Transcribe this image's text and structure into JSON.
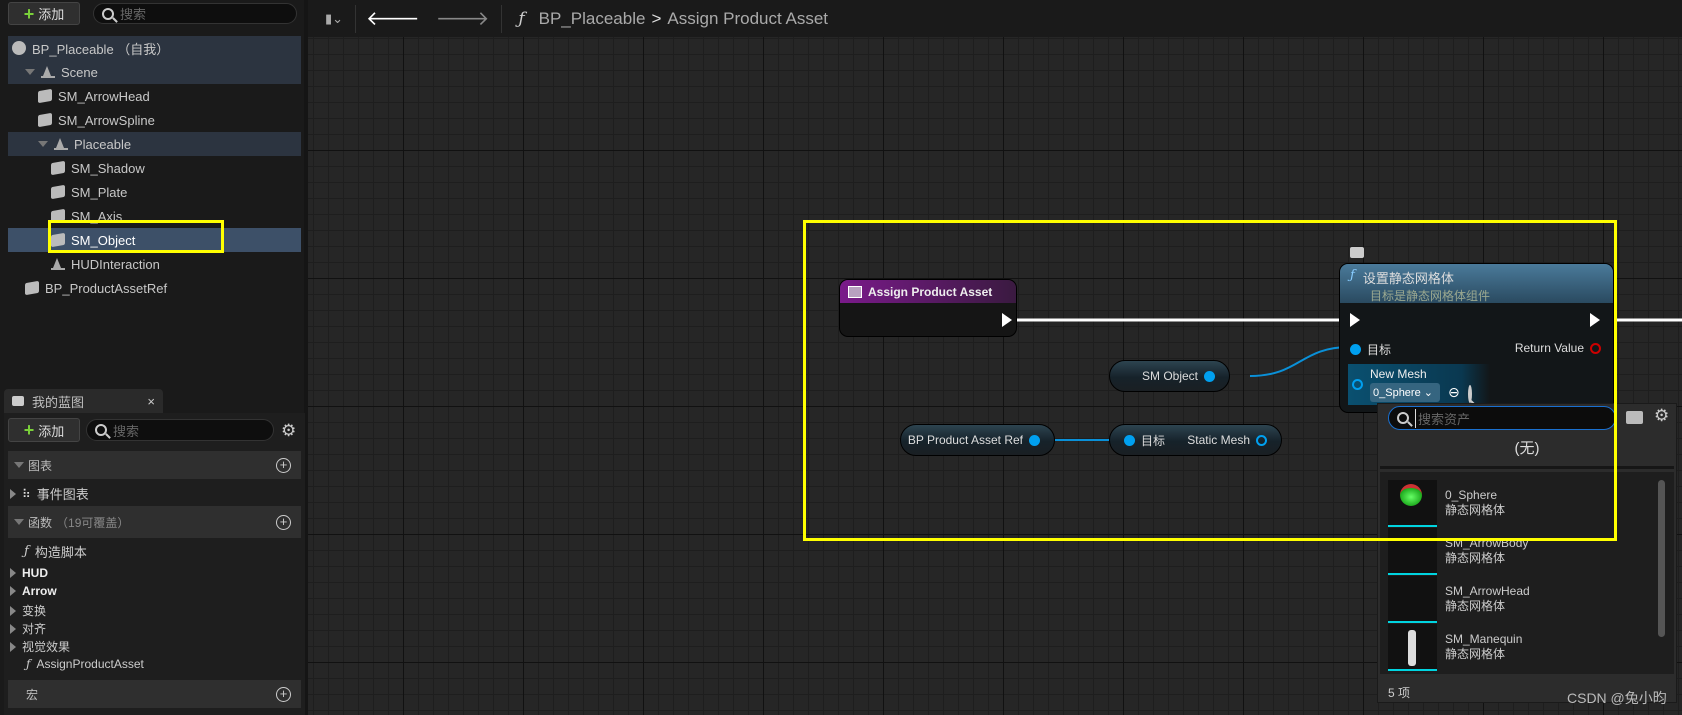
{
  "components": {
    "add_label": "添加",
    "search_placeholder": "搜索",
    "tree": [
      {
        "label": "BP_Placeable （自我）",
        "icon": "actor-icon",
        "level": 0
      },
      {
        "label": "Scene",
        "icon": "scene-component-icon",
        "level": 1,
        "expanded": true
      },
      {
        "label": "SM_ArrowHead",
        "icon": "static-mesh-icon",
        "level": 2
      },
      {
        "label": "SM_ArrowSpline",
        "icon": "static-mesh-icon",
        "level": 2
      },
      {
        "label": "Placeable",
        "icon": "scene-component-icon",
        "level": 2,
        "expanded": true
      },
      {
        "label": "SM_Shadow",
        "icon": "static-mesh-icon",
        "level": 3
      },
      {
        "label": "SM_Plate",
        "icon": "static-mesh-icon",
        "level": 3
      },
      {
        "label": "SM_Axis",
        "icon": "static-mesh-icon",
        "level": 3
      },
      {
        "label": "SM_Object",
        "icon": "static-mesh-icon",
        "level": 3,
        "selected": true
      },
      {
        "label": "HUDInteraction",
        "icon": "scene-component-icon",
        "level": 3
      },
      {
        "label": "BP_ProductAssetRef",
        "icon": "child-actor-icon",
        "level": 1
      }
    ]
  },
  "my_blueprint": {
    "tab_label": "我的蓝图",
    "close": "×",
    "add_label": "添加",
    "search_placeholder": "搜索",
    "graphs_header": "图表",
    "event_graph": "事件图表",
    "functions_header": "函数",
    "functions_count": "（19可覆盖）",
    "construction_script": "构造脚本",
    "categories": [
      "HUD",
      "Arrow",
      "变换",
      "对齐",
      "视觉效果"
    ],
    "function_item": "AssignProductAsset",
    "macros_header": "宏"
  },
  "toolbar": {
    "breadcrumb_root": "BP_Placeable",
    "breadcrumb_sep": ">",
    "breadcrumb_current": "Assign Product Asset"
  },
  "graph": {
    "entry_node": {
      "title": "Assign Product Asset",
      "color": "#7a1a8a"
    },
    "set_node": {
      "title": "设置静态网格体",
      "subtitle": "目标是静态网格体组件",
      "target_label": "目标",
      "return_label": "Return Value",
      "new_mesh_label": "New Mesh",
      "new_mesh_value": "0_Sphere"
    },
    "sm_object_node": {
      "label": "SM Object"
    },
    "bp_ref_node": {
      "label": "BP Product Asset Ref"
    },
    "get_mesh_node": {
      "target_label": "目标",
      "output_label": "Static Mesh"
    },
    "highlight_color": "#ffff00"
  },
  "asset_picker": {
    "search_placeholder": "搜索资产",
    "none_label": "(无)",
    "items": [
      {
        "name": "0_Sphere",
        "type": "静态网格体"
      },
      {
        "name": "SM_ArrowBody",
        "type": "静态网格体"
      },
      {
        "name": "SM_ArrowHead",
        "type": "静态网格体"
      },
      {
        "name": "SM_Manequin",
        "type": "静态网格体"
      }
    ],
    "count": "5 项"
  },
  "watermark": "CSDN @兔小昀"
}
